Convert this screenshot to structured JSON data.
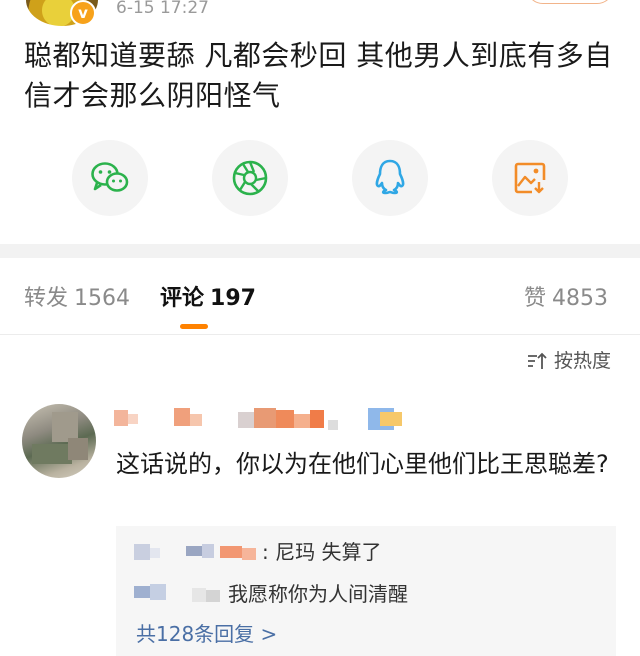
{
  "post": {
    "timestamp": "6-15 17:27",
    "verified_badge": "v",
    "text": "聪都知道要舔 凡都会秒回 其他男人到底有多自信才会那么阴阳怪气"
  },
  "share": {
    "items": [
      "wechat-icon",
      "moments-icon",
      "qq-icon",
      "save-image-icon"
    ],
    "colors": {
      "wechat": "#2bb24c",
      "moments": "#2bb24c",
      "qq": "#2fa7e5",
      "save": "#f28c28"
    }
  },
  "tabs": {
    "repost_label": "转发",
    "repost_count": "1564",
    "comment_label": "评论",
    "comment_count": "197",
    "like_label": "赞",
    "like_count": "4853",
    "accent": "#ff8200"
  },
  "sort": {
    "label": "按热度"
  },
  "comment": {
    "text": "这话说的，你以为在他们心里他们比王思聪差?",
    "replies": [
      {
        "text": ": 尼玛 失算了"
      },
      {
        "text": "我愿称你为人间清醒"
      }
    ],
    "more_replies": "共128条回复 >"
  }
}
